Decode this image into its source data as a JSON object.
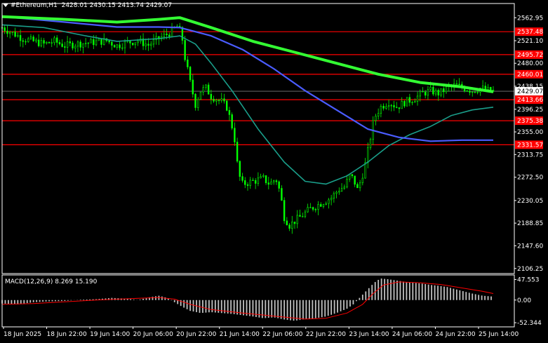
{
  "header": {
    "symbol": "#Ethereum,H1",
    "ohlc": "2428.01 2430.15 2413.74 2429.07"
  },
  "macd_header": {
    "label": "MACD(12,26,9)",
    "values": "8.269 15.190"
  },
  "colors": {
    "background": "#000000",
    "frame": "#ffffff",
    "bull_candle": "#00ff00",
    "bear_candle": "#00ff00",
    "ma_fast": "#1a9e8a",
    "ma_mid": "#4a5cff",
    "ma_slow": "#33ff33",
    "level_line": "#ff0000",
    "macd_hist": "#c0c0c0",
    "macd_signal": "#ff0000",
    "price_tag_bg": "#ff0000",
    "current_tag_bg": "#ffffff"
  },
  "chart_data": {
    "type": "line",
    "price_axis": {
      "ylim": [
        2097,
        2585
      ],
      "ticks": [
        2562.95,
        2521.1,
        2480.0,
        2438.15,
        2396.25,
        2355.0,
        2313.75,
        2272.5,
        2230.05,
        2188.85,
        2147.6,
        2106.25
      ]
    },
    "levels": [
      2537.48,
      2495.72,
      2460.01,
      2413.66,
      2375.38,
      2331.57
    ],
    "current_price": 2429.07,
    "x_labels": [
      "18 Jun 2025",
      "18 Jun 22:00",
      "19 Jun 14:00",
      "20 Jun 06:00",
      "20 Jun 22:00",
      "21 Jun 14:00",
      "22 Jun 06:00",
      "22 Jun 22:00",
      "23 Jun 14:00",
      "24 Jun 06:00",
      "24 Jun 22:00",
      "25 Jun 14:00"
    ],
    "close_path": [
      [
        0,
        2545
      ],
      [
        10,
        2535
      ],
      [
        20,
        2525
      ],
      [
        30,
        2520
      ],
      [
        40,
        2515
      ],
      [
        50,
        2520
      ],
      [
        60,
        2512
      ],
      [
        70,
        2515
      ],
      [
        80,
        2517
      ],
      [
        90,
        2519
      ],
      [
        100,
        2521
      ],
      [
        110,
        2512
      ],
      [
        120,
        2518
      ],
      [
        130,
        2521
      ],
      [
        140,
        2513
      ],
      [
        150,
        2525
      ],
      [
        160,
        2535
      ],
      [
        168,
        2548
      ],
      [
        172,
        2530
      ],
      [
        175,
        2490
      ],
      [
        180,
        2445
      ],
      [
        185,
        2405
      ],
      [
        190,
        2430
      ],
      [
        195,
        2435
      ],
      [
        200,
        2420
      ],
      [
        205,
        2415
      ],
      [
        210,
        2410
      ],
      [
        215,
        2400
      ],
      [
        218,
        2380
      ],
      [
        222,
        2350
      ],
      [
        226,
        2280
      ],
      [
        230,
        2260
      ],
      [
        240,
        2265
      ],
      [
        250,
        2270
      ],
      [
        256,
        2260
      ],
      [
        262,
        2270
      ],
      [
        266,
        2245
      ],
      [
        270,
        2200
      ],
      [
        275,
        2185
      ],
      [
        285,
        2200
      ],
      [
        295,
        2215
      ],
      [
        305,
        2225
      ],
      [
        315,
        2235
      ],
      [
        322,
        2250
      ],
      [
        328,
        2255
      ],
      [
        332,
        2275
      ],
      [
        336,
        2270
      ],
      [
        340,
        2250
      ],
      [
        344,
        2270
      ],
      [
        348,
        2300
      ],
      [
        352,
        2340
      ],
      [
        356,
        2380
      ],
      [
        362,
        2400
      ],
      [
        370,
        2410
      ],
      [
        378,
        2400
      ],
      [
        386,
        2410
      ],
      [
        394,
        2415
      ],
      [
        402,
        2425
      ],
      [
        410,
        2430
      ],
      [
        418,
        2425
      ],
      [
        426,
        2435
      ],
      [
        434,
        2440
      ],
      [
        442,
        2435
      ],
      [
        450,
        2430
      ],
      [
        458,
        2435
      ],
      [
        466,
        2430
      ],
      [
        470,
        2429.07
      ]
    ],
    "ma_slow": [
      [
        0,
        2565
      ],
      [
        60,
        2560
      ],
      [
        110,
        2555
      ],
      [
        150,
        2560
      ],
      [
        170,
        2563
      ],
      [
        200,
        2545
      ],
      [
        240,
        2520
      ],
      [
        280,
        2500
      ],
      [
        320,
        2480
      ],
      [
        360,
        2460
      ],
      [
        400,
        2445
      ],
      [
        440,
        2437
      ],
      [
        470,
        2428
      ]
    ],
    "ma_mid": [
      [
        0,
        2565
      ],
      [
        60,
        2555
      ],
      [
        110,
        2546
      ],
      [
        150,
        2546
      ],
      [
        170,
        2545
      ],
      [
        200,
        2530
      ],
      [
        230,
        2505
      ],
      [
        260,
        2470
      ],
      [
        290,
        2430
      ],
      [
        320,
        2395
      ],
      [
        350,
        2360
      ],
      [
        380,
        2345
      ],
      [
        410,
        2338
      ],
      [
        440,
        2340
      ],
      [
        470,
        2340
      ]
    ],
    "ma_fast": [
      [
        0,
        2550
      ],
      [
        40,
        2545
      ],
      [
        80,
        2530
      ],
      [
        110,
        2520
      ],
      [
        150,
        2525
      ],
      [
        170,
        2530
      ],
      [
        185,
        2515
      ],
      [
        200,
        2480
      ],
      [
        220,
        2430
      ],
      [
        245,
        2360
      ],
      [
        270,
        2300
      ],
      [
        290,
        2265
      ],
      [
        310,
        2260
      ],
      [
        330,
        2275
      ],
      [
        350,
        2300
      ],
      [
        370,
        2330
      ],
      [
        390,
        2350
      ],
      [
        410,
        2365
      ],
      [
        430,
        2385
      ],
      [
        450,
        2395
      ],
      [
        470,
        2400
      ]
    ],
    "candle_spread": 14,
    "macd": {
      "ylim": [
        -62,
        58
      ],
      "ticks": [
        47.553,
        0.0,
        -52.344
      ],
      "hist": [
        [
          0,
          -8
        ],
        [
          15,
          -10
        ],
        [
          30,
          -5
        ],
        [
          45,
          -3
        ],
        [
          60,
          -2
        ],
        [
          75,
          1
        ],
        [
          90,
          2
        ],
        [
          105,
          5
        ],
        [
          120,
          3
        ],
        [
          130,
          0
        ],
        [
          140,
          6
        ],
        [
          150,
          10
        ],
        [
          158,
          5
        ],
        [
          165,
          -5
        ],
        [
          172,
          -15
        ],
        [
          180,
          -25
        ],
        [
          190,
          -30
        ],
        [
          200,
          -28
        ],
        [
          210,
          -30
        ],
        [
          220,
          -32
        ],
        [
          230,
          -35
        ],
        [
          240,
          -38
        ],
        [
          250,
          -42
        ],
        [
          260,
          -40
        ],
        [
          270,
          -45
        ],
        [
          280,
          -48
        ],
        [
          290,
          -44
        ],
        [
          300,
          -42
        ],
        [
          310,
          -38
        ],
        [
          320,
          -30
        ],
        [
          330,
          -20
        ],
        [
          336,
          -10
        ],
        [
          342,
          5
        ],
        [
          350,
          25
        ],
        [
          356,
          40
        ],
        [
          362,
          50
        ],
        [
          370,
          48
        ],
        [
          378,
          45
        ],
        [
          386,
          42
        ],
        [
          394,
          40
        ],
        [
          402,
          38
        ],
        [
          410,
          35
        ],
        [
          418,
          33
        ],
        [
          426,
          30
        ],
        [
          434,
          25
        ],
        [
          442,
          20
        ],
        [
          450,
          15
        ],
        [
          460,
          10
        ],
        [
          470,
          8
        ]
      ],
      "signal": [
        [
          0,
          -10
        ],
        [
          30,
          -8
        ],
        [
          60,
          -4
        ],
        [
          90,
          0
        ],
        [
          120,
          3
        ],
        [
          150,
          6
        ],
        [
          165,
          2
        ],
        [
          180,
          -10
        ],
        [
          200,
          -22
        ],
        [
          230,
          -30
        ],
        [
          260,
          -37
        ],
        [
          290,
          -44
        ],
        [
          310,
          -42
        ],
        [
          330,
          -30
        ],
        [
          345,
          -10
        ],
        [
          355,
          15
        ],
        [
          365,
          35
        ],
        [
          380,
          42
        ],
        [
          400,
          40
        ],
        [
          420,
          36
        ],
        [
          440,
          28
        ],
        [
          460,
          20
        ],
        [
          470,
          15
        ]
      ]
    }
  }
}
